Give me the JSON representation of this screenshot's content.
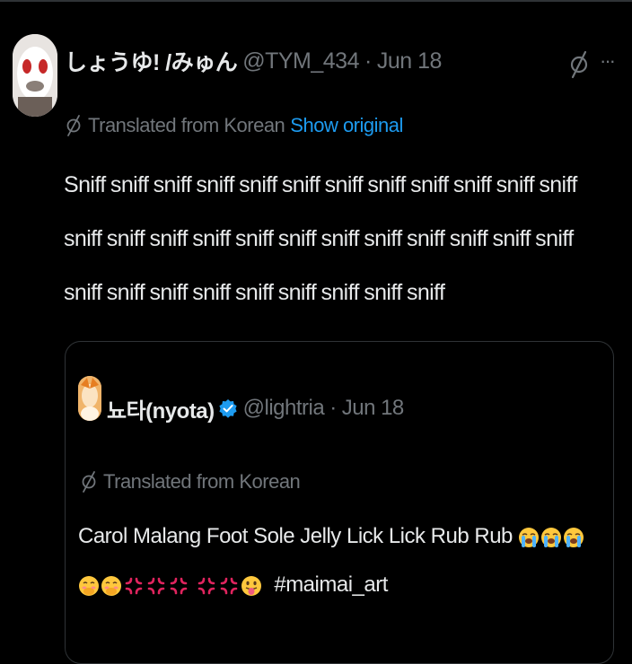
{
  "tweet": {
    "display_name": "しょうゆ! /みゅん",
    "handle": "@TYM_434",
    "separator": "·",
    "time": "Jun 18",
    "translated_label": "Translated from Korean",
    "show_original_label": "Show original",
    "text": "Sniff sniff sniff sniff sniff sniff sniff sniff sniff sniff sniff sniff sniff sniff sniff sniff sniff sniff sniff sniff sniff sniff sniff sniff sniff sniff sniff sniff sniff sniff sniff sniff sniff"
  },
  "quote": {
    "display_name": "뇨타(nyota)",
    "handle": "@lightria",
    "separator": "·",
    "time": "Jun 18",
    "translated_label": "Translated from Korean",
    "text": "Carol Malang Foot Sole Jelly Lick Lick Rub Rub",
    "hashtag": "#maimai_art",
    "emojis": [
      "loudly-crying-face",
      "loudly-crying-face",
      "loudly-crying-face",
      "face-with-hand-over-mouth",
      "face-with-hand-over-mouth",
      "anger-symbol",
      "anger-symbol",
      "anger-symbol",
      "anger-symbol",
      "anger-symbol",
      "face-with-tongue"
    ]
  },
  "colors": {
    "background": "#000000",
    "text": "#e7e9ea",
    "secondary": "#71767b",
    "link": "#1d9bf0",
    "border": "#2f3336"
  }
}
